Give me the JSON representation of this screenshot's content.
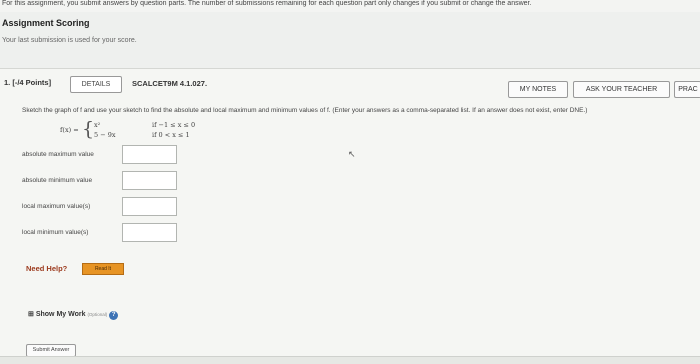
{
  "assignment": {
    "intro_text": "For this assignment, you submit answers by question parts. The number of submissions remaining for each question part only changes if you submit or change the answer.",
    "scoring_title": "Assignment Scoring",
    "scoring_note": "Your last submission is used for your score."
  },
  "question": {
    "number_points": "1. [-/4 Points]",
    "details_label": "DETAILS",
    "code": "SCALCET9M 4.1.027.",
    "my_notes_label": "MY NOTES",
    "ask_teacher_label": "ASK YOUR TEACHER",
    "practice_label": "PRAC",
    "prompt": "Sketch the graph of f and use your sketch to find the absolute and local maximum and minimum values of f. (Enter your answers as a comma-separated list. If an answer does not exist, enter DNE.)",
    "function": {
      "lhs": "f(x) =",
      "piece1_expr": "x²",
      "piece1_cond": "if −1 ≤ x ≤ 0",
      "piece2_expr": "5 − 9x",
      "piece2_cond": "if 0 < x ≤ 1"
    },
    "rows": [
      {
        "label": "absolute maximum value",
        "value": ""
      },
      {
        "label": "absolute minimum value",
        "value": ""
      },
      {
        "label": "local maximum value(s)",
        "value": ""
      },
      {
        "label": "local minimum value(s)",
        "value": ""
      }
    ],
    "help_label": "Need Help?",
    "read_it_label": "Read It",
    "show_work_label": "Show My Work",
    "show_work_optional": "(Optional)",
    "submit_label": "Submit Answer"
  }
}
